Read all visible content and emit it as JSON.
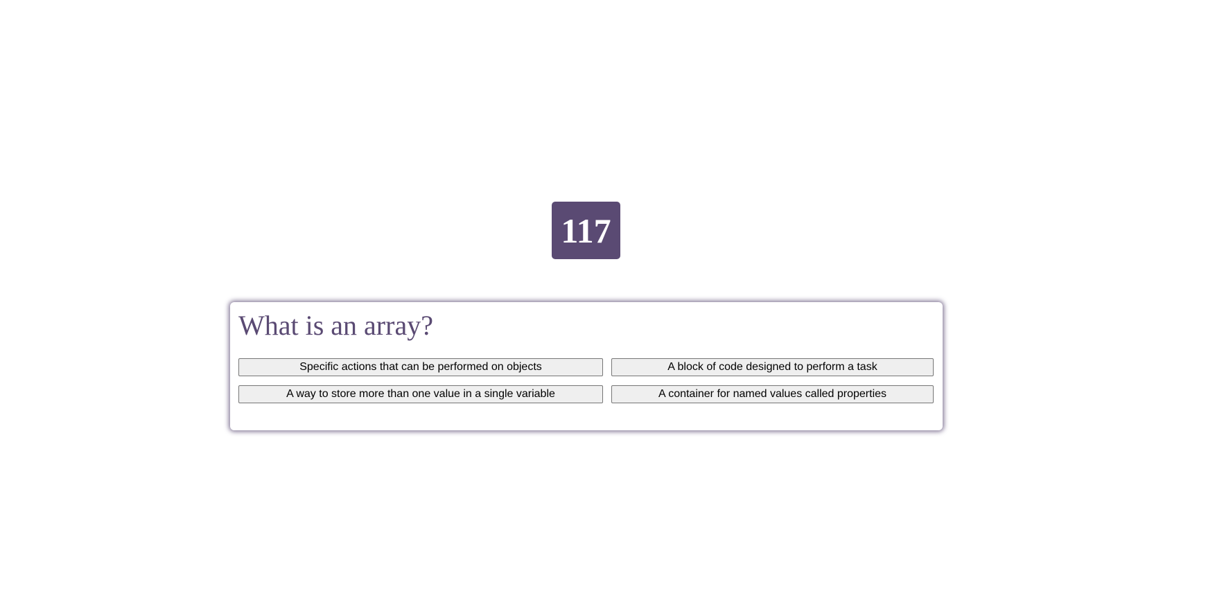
{
  "timer": {
    "value": "117"
  },
  "quiz": {
    "question": "What is an array?",
    "answers": [
      "Specific actions that can be performed on objects",
      "A block of code designed to perform a task",
      "A way to store more than one value in a single variable",
      "A container for named values called properties"
    ]
  },
  "colors": {
    "accent": "#5a4a73",
    "button_bg": "#efefef",
    "button_border": "#767676",
    "background": "#ffffff"
  }
}
